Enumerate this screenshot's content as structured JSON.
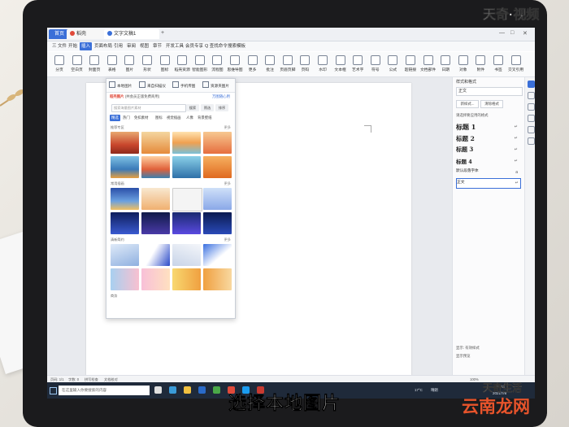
{
  "watermarks": {
    "top_right": "天奇·视频",
    "bottom_right": "天奇生活",
    "site": "云南龙网"
  },
  "caption": "选择本地图片",
  "titlebar": {
    "tabs": [
      {
        "label": "首页"
      },
      {
        "label": "稻壳"
      },
      {
        "label": "文字文稿1"
      }
    ],
    "new_tab": "+"
  },
  "menu": {
    "items": [
      "三 文件",
      "开始",
      "插入",
      "页面布局",
      "引用",
      "审阅",
      "视图",
      "章节",
      "开发工具",
      "会员专享",
      "Q 查找命令",
      "搜索模板"
    ],
    "active": "插入"
  },
  "ribbon": {
    "buttons": [
      "分页",
      "空白页",
      "封面页",
      "表格",
      "图片",
      "形状",
      "图标",
      "稻壳资源",
      "智能图形",
      "流程图",
      "思维导图",
      "更多",
      "批注",
      "页眉页脚",
      "页码",
      "水印",
      "文本框",
      "艺术字",
      "符号",
      "公式",
      "超链接",
      "文档部件",
      "日期",
      "对象",
      "附件",
      "书签",
      "交叉引用"
    ]
  },
  "picture_panel": {
    "top_options": [
      "本地图片",
      "来自扫描仪",
      "手机传图",
      "资源夹图片"
    ],
    "header": {
      "brand": "稻壳图片",
      "note": "(共会员正版免费商用)",
      "link": "万图随心用"
    },
    "search_placeholder": "搜索海量图片素材",
    "search_buttons": [
      "搜索",
      "筛选",
      "排序"
    ],
    "categories": [
      "精选",
      "热门",
      "免扣素材",
      "图标",
      "视觉插画",
      "人像",
      "背景壁纸"
    ],
    "active_category": "精选",
    "sections": [
      {
        "title": "推荐专区",
        "more": "更多"
      },
      {
        "title": "常用插画",
        "more": "更多"
      },
      {
        "title": "清新简约",
        "more": "更多"
      },
      {
        "title": "商务",
        "more": ""
      }
    ]
  },
  "style_panel": {
    "title": "样式和格式",
    "current": "正文",
    "buttons": [
      "新样式...",
      "清除格式"
    ],
    "section_label": "请选择要应用的格式",
    "styles": [
      "标题 1",
      "标题 2",
      "标题 3",
      "标题 4",
      "默认段落字体",
      "正文"
    ],
    "show_label": "显示: 有效样式",
    "preview_label": "显示预览"
  },
  "status": {
    "page": "页码: 1/1",
    "words": "字数: 0",
    "spell": "拼写检查",
    "doc": "文档校对",
    "zoom": "100%"
  },
  "taskbar": {
    "search_placeholder": "在这里输入你要搜索的内容",
    "temp": "17°C",
    "weather": "晴朗",
    "time": "19:53",
    "date": "2021/7/8"
  },
  "colors": {
    "accent": "#3a6fd8",
    "taskbar": "#1f2a3a",
    "site_wm": "#e8542b"
  }
}
